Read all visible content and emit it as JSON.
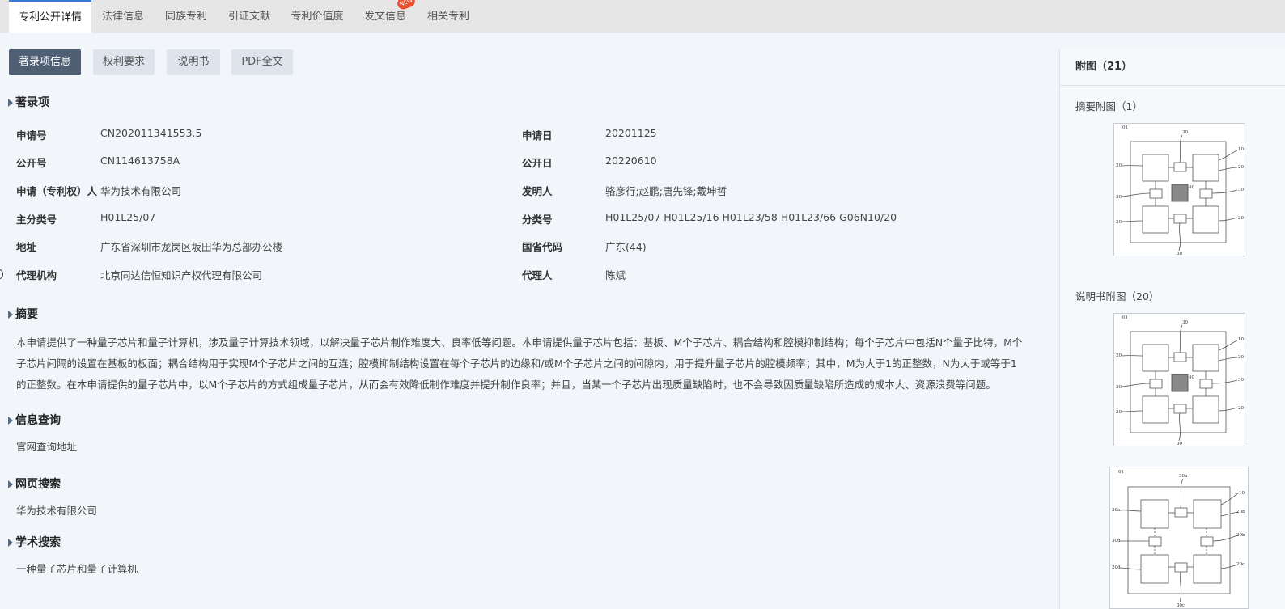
{
  "tabs": [
    {
      "label": "专利公开详情",
      "active": true
    },
    {
      "label": "法律信息"
    },
    {
      "label": "同族专利"
    },
    {
      "label": "引证文献"
    },
    {
      "label": "专利价值度"
    },
    {
      "label": "发文信息",
      "badge": "NEW"
    },
    {
      "label": "相关专利"
    }
  ],
  "subtabs": [
    {
      "label": "著录项信息",
      "active": true
    },
    {
      "label": "权利要求"
    },
    {
      "label": "说明书"
    },
    {
      "label": "PDF全文"
    }
  ],
  "biblio": {
    "title": "著录项",
    "rows": [
      {
        "l1": "申请号",
        "v1": "CN202011341553.5",
        "l2": "申请日",
        "v2": "20201125"
      },
      {
        "l1": "公开号",
        "v1": "CN114613758A",
        "l2": "公开日",
        "v2": "20220610"
      },
      {
        "l1": "申请（专利权）人",
        "v1": "华为技术有限公司",
        "l2": "发明人",
        "v2": "骆彦行;赵鹏;唐先锋;戴坤哲"
      },
      {
        "l1": "主分类号",
        "v1": "H01L25/07",
        "l2": "分类号",
        "v2": "H01L25/07 H01L25/16 H01L23/58 H01L23/66 G06N10/20"
      },
      {
        "l1": "地址",
        "v1": "广东省深圳市龙岗区坂田华为总部办公楼",
        "l2": "国省代码",
        "v2": "广东(44)"
      },
      {
        "l1": "代理机构",
        "v1": "北京同达信恒知识产权代理有限公司",
        "l2": "代理人",
        "v2": "陈斌"
      }
    ]
  },
  "abstract": {
    "title": "摘要",
    "text": "本申请提供了一种量子芯片和量子计算机，涉及量子计算技术领域，以解决量子芯片制作难度大、良率低等问题。本申请提供量子芯片包括：基板、M个子芯片、耦合结构和腔模抑制结构；每个子芯片中包括N个量子比特，M个子芯片间隔的设置在基板的板面；耦合结构用于实现M个子芯片之间的互连；腔模抑制结构设置在每个子芯片的边缘和/或M个子芯片之间的间隙内，用于提升量子芯片的腔模频率；其中，M为大于1的正整数，N为大于或等于1的正整数。在本申请提供的量子芯片中，以M个子芯片的方式组成量子芯片，从而会有效降低制作难度并提升制作良率；并且，当某一个子芯片出现质量缺陷时，也不会导致因质量缺陷所造成的成本大、资源浪费等问题。"
  },
  "info_query": {
    "title": "信息查询",
    "link": "官网查询地址"
  },
  "web_search": {
    "title": "网页搜索",
    "text": "华为技术有限公司"
  },
  "academic_search": {
    "title": "学术搜索",
    "text": "一种量子芯片和量子计算机"
  },
  "side": {
    "header": "附图（21）",
    "abstract_fig": "摘要附图（1）",
    "desc_fig": "说明书附图（20）"
  },
  "figure_labels": {
    "a": {
      "corner": "01",
      "top": "30",
      "r1": "10",
      "r2": "20",
      "r3": "30",
      "r4": "20",
      "l1": "20",
      "l2": "30",
      "l3": "20",
      "center": "40",
      "bottom": "30"
    },
    "b": {
      "corner": "01",
      "top": "30a",
      "r1": "10",
      "r2": "20b",
      "r3": "30b",
      "r4": "20c",
      "l1": "20a",
      "l2": "30d",
      "l3": "20d",
      "bottom": "30c"
    }
  }
}
